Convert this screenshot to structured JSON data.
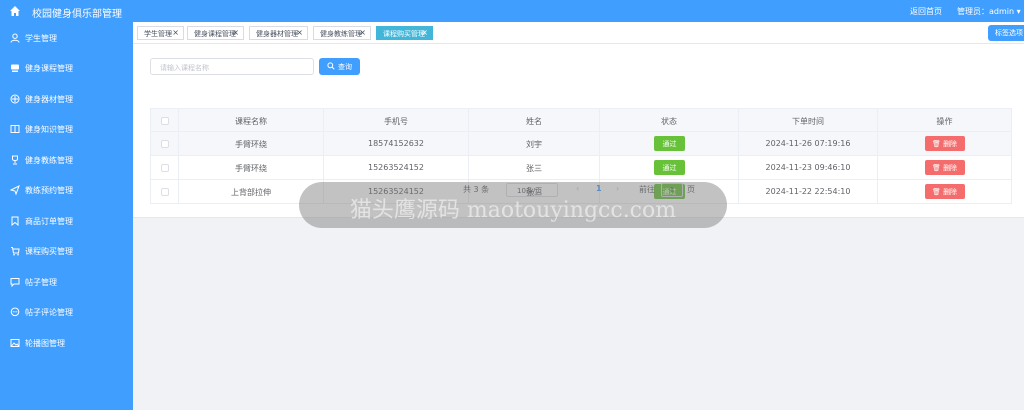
{
  "topbar": {
    "title": "校园健身俱乐部管理",
    "back_link": "返回首页",
    "admin_label": "管理员：admin ▾"
  },
  "sidebar": {
    "items": [
      {
        "label": "学生管理",
        "icon": "user-icon"
      },
      {
        "label": "健身课程管理",
        "icon": "course-icon"
      },
      {
        "label": "健身器材管理",
        "icon": "equipment-icon"
      },
      {
        "label": "健身知识管理",
        "icon": "book-icon"
      },
      {
        "label": "健身教练管理",
        "icon": "trophy-icon"
      },
      {
        "label": "教练预约管理",
        "icon": "send-icon"
      },
      {
        "label": "商品订单管理",
        "icon": "bookmark-icon"
      },
      {
        "label": "课程购买管理",
        "icon": "cart-icon"
      },
      {
        "label": "帖子管理",
        "icon": "chat-icon"
      },
      {
        "label": "帖子评论管理",
        "icon": "comment-icon"
      },
      {
        "label": "轮播图管理",
        "icon": "image-icon"
      }
    ]
  },
  "tabs": [
    {
      "label": "学生管理"
    },
    {
      "label": "健身课程管理"
    },
    {
      "label": "健身器材管理"
    },
    {
      "label": "健身教练管理"
    },
    {
      "label": "课程购买管理",
      "active": true
    }
  ],
  "tag_options_label": "标签选项",
  "search": {
    "placeholder": "请输入课程名称",
    "button_label": "查询"
  },
  "table": {
    "headers": [
      "课程名称",
      "手机号",
      "姓名",
      "状态",
      "下单时间",
      "操作"
    ],
    "rows": [
      {
        "course": "手臂环绕",
        "phone": "18574152632",
        "name": "刘宇",
        "status": "通过",
        "time": "2024-11-26 07:19:16",
        "action": "删除"
      },
      {
        "course": "手臂环绕",
        "phone": "15263524152",
        "name": "张三",
        "status": "通过",
        "time": "2024-11-23 09:46:10",
        "action": "删除"
      },
      {
        "course": "上背部拉伸",
        "phone": "15263524152",
        "name": "张三",
        "status": "通过",
        "time": "2024-11-22 22:54:10",
        "action": "删除"
      }
    ]
  },
  "pagination": {
    "total": "共 3 条",
    "page_size": "10条/页",
    "prev": "‹",
    "current_page": "1",
    "next": "›",
    "goto_label": "前往",
    "goto_value": "1",
    "page_unit": "页"
  },
  "watermark": "猫头鹰源码 maotouyingcc.com",
  "colors": {
    "primary": "#409eff",
    "active_tab": "#42b6d8",
    "success": "#67c23a",
    "danger": "#f56c6c"
  }
}
